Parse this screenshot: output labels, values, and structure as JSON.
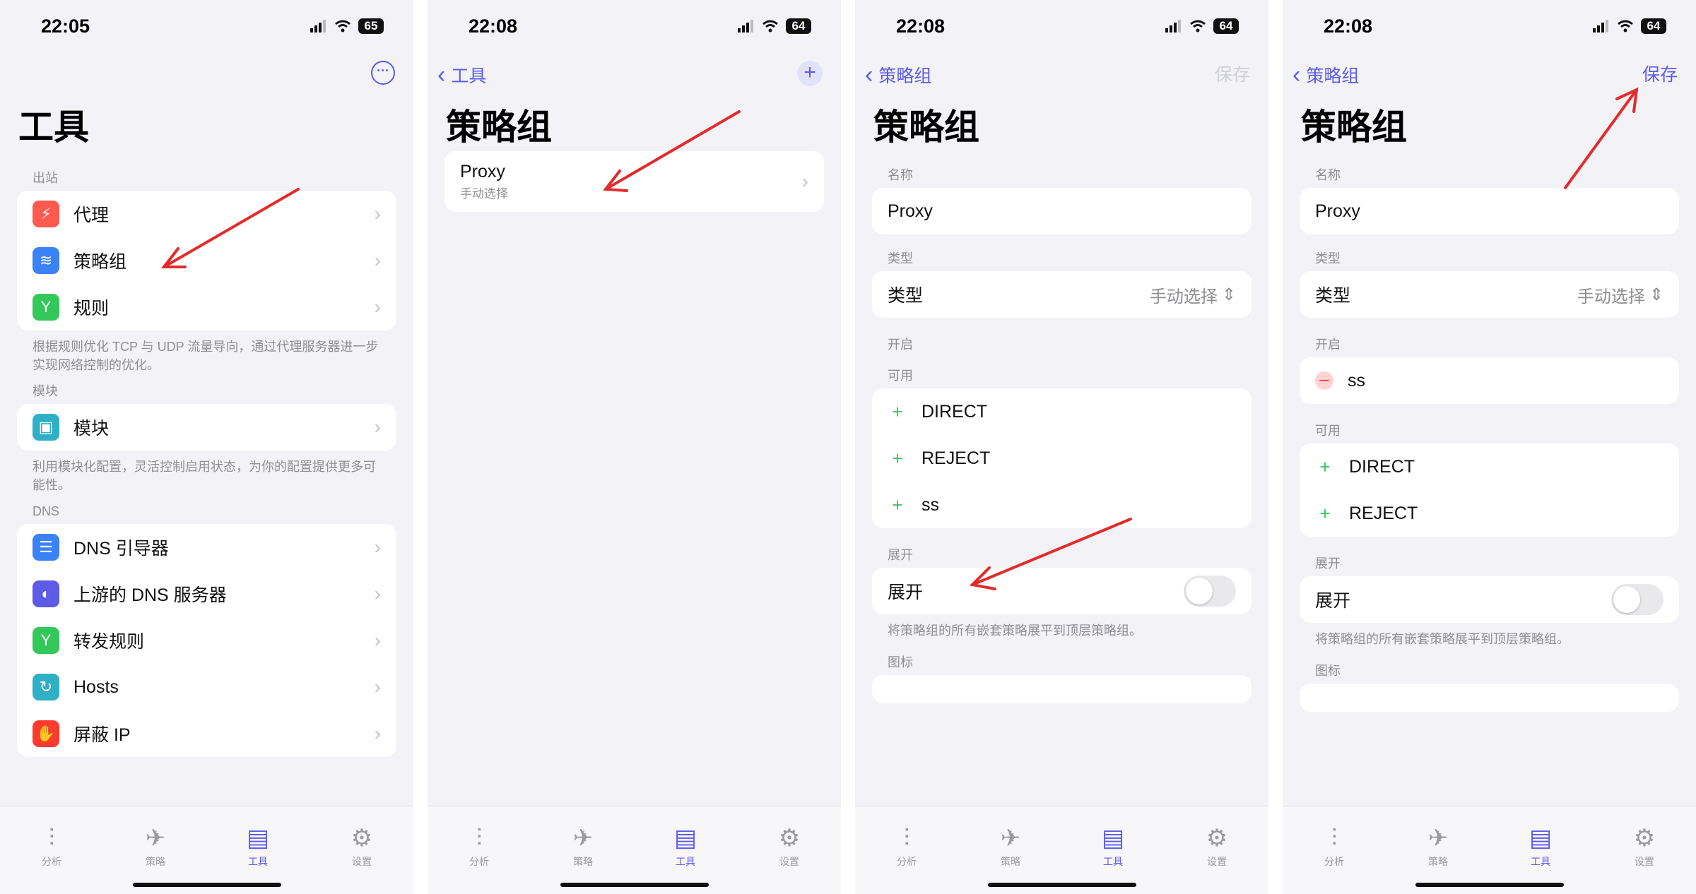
{
  "colors": {
    "accent": "#5e5ce6",
    "annotation_arrow": "#e32b2b",
    "plus_green": "#34c759",
    "minus_red": "#ff3b30"
  },
  "screens": [
    {
      "time": "22:05",
      "battery": "65",
      "title": "工具",
      "sections": [
        {
          "header": "出站",
          "footer": "根据规则优化 TCP 与 UDP 流量导向，通过代理服务器进一步实现网络控制的优化。",
          "items": [
            {
              "label": "代理",
              "icon": "bolt-icon",
              "color": "#ff5a4e"
            },
            {
              "label": "策略组",
              "icon": "layers-icon",
              "color": "#3b82f6"
            },
            {
              "label": "规则",
              "icon": "fork-icon",
              "color": "#34c759"
            }
          ]
        },
        {
          "header": "模块",
          "footer": "利用模块化配置，灵活控制启用状态，为你的配置提供更多可能性。",
          "items": [
            {
              "label": "模块",
              "icon": "module-icon",
              "color": "#30b0c7"
            }
          ]
        },
        {
          "header": "DNS",
          "footer": "",
          "items": [
            {
              "label": "DNS 引导器",
              "icon": "server-icon",
              "color": "#3b82f6"
            },
            {
              "label": "上游的 DNS 服务器",
              "icon": "shield-icon",
              "color": "#5e5ce6"
            },
            {
              "label": "转发规则",
              "icon": "fork-icon",
              "color": "#34c759"
            },
            {
              "label": "Hosts",
              "icon": "refresh-icon",
              "color": "#30b0c7"
            },
            {
              "label": "屏蔽 IP",
              "icon": "hand-icon",
              "color": "#ff3b30"
            }
          ]
        }
      ]
    },
    {
      "time": "22:08",
      "battery": "64",
      "back": "工具",
      "title": "策略组",
      "group": {
        "name": "Proxy",
        "subtitle": "手动选择"
      }
    },
    {
      "time": "22:08",
      "battery": "64",
      "back": "策略组",
      "title": "策略组",
      "save": "保存",
      "name_header": "名称",
      "name_value": "Proxy",
      "type_header": "类型",
      "type_label": "类型",
      "type_value": "手动选择",
      "enabled_header": "开启",
      "enabled": [],
      "available_header": "可用",
      "available": [
        "DIRECT",
        "REJECT",
        "ss"
      ],
      "expand_header": "展开",
      "expand_label": "展开",
      "expand_footer": "将策略组的所有嵌套策略展平到顶层策略组。",
      "icon_header": "图标"
    },
    {
      "time": "22:08",
      "battery": "64",
      "back": "策略组",
      "title": "策略组",
      "save": "保存",
      "name_header": "名称",
      "name_value": "Proxy",
      "type_header": "类型",
      "type_label": "类型",
      "type_value": "手动选择",
      "enabled_header": "开启",
      "enabled": [
        "ss"
      ],
      "available_header": "可用",
      "available": [
        "DIRECT",
        "REJECT"
      ],
      "expand_header": "展开",
      "expand_label": "展开",
      "expand_footer": "将策略组的所有嵌套策略展平到顶层策略组。",
      "icon_header": "图标"
    }
  ],
  "tabbar": [
    {
      "label": "分析",
      "icon": "waveform-icon"
    },
    {
      "label": "策略",
      "icon": "airplane-icon"
    },
    {
      "label": "工具",
      "icon": "toolbox-icon",
      "active": true
    },
    {
      "label": "设置",
      "icon": "gear-icon"
    }
  ]
}
